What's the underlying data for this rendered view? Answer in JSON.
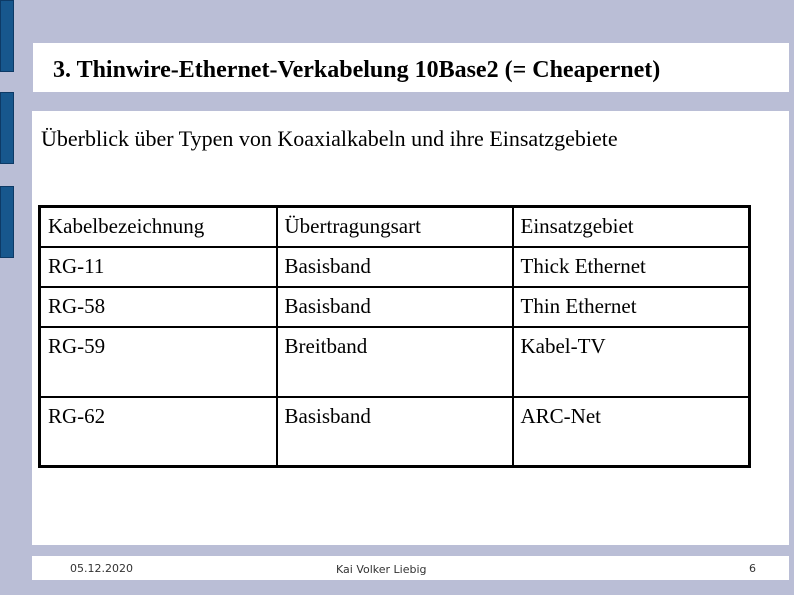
{
  "slide": {
    "title": "3. Thinwire-Ethernet-Verkabelung 10Base2 (= Cheapernet)",
    "subtitle": "Überblick über Typen von Koaxialkabeln und ihre Einsatzgebiete",
    "table": {
      "headers": [
        "Kabelbezeichnung",
        "Übertragungsart",
        "Einsatzgebiet"
      ],
      "rows": [
        [
          "RG-11",
          "Basisband",
          "Thick Ethernet"
        ],
        [
          "RG-58",
          "Basisband",
          "Thin Ethernet"
        ],
        [
          "RG-59",
          "Breitband",
          "Kabel-TV"
        ],
        [
          "RG-62",
          "Basisband",
          "ARC-Net"
        ]
      ]
    },
    "footer": {
      "date": "05.12.2020",
      "author": "Kai Volker Liebig",
      "page": "6"
    }
  }
}
